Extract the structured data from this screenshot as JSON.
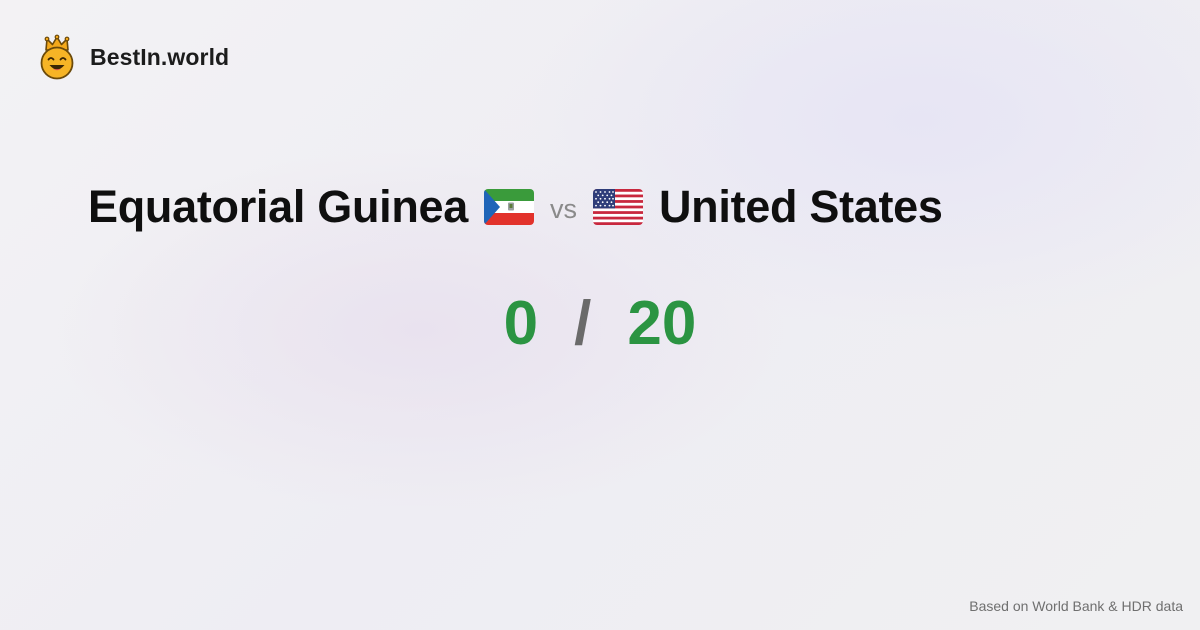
{
  "brand": {
    "name": "BestIn.world",
    "logo_icon": "crown-smiley-icon"
  },
  "comparison": {
    "left": {
      "name": "Equatorial Guinea",
      "flag_icon": "equatorial-guinea-flag-icon",
      "score": "0"
    },
    "vs_label": "vs",
    "right": {
      "name": "United States",
      "flag_icon": "united-states-flag-icon",
      "score": "20"
    },
    "separator": "/"
  },
  "footer": {
    "note": "Based on World Bank & HDR data"
  },
  "colors": {
    "score_green": "#2b9442",
    "text_dark": "#0f0f0f",
    "muted": "#8a8a8a"
  }
}
